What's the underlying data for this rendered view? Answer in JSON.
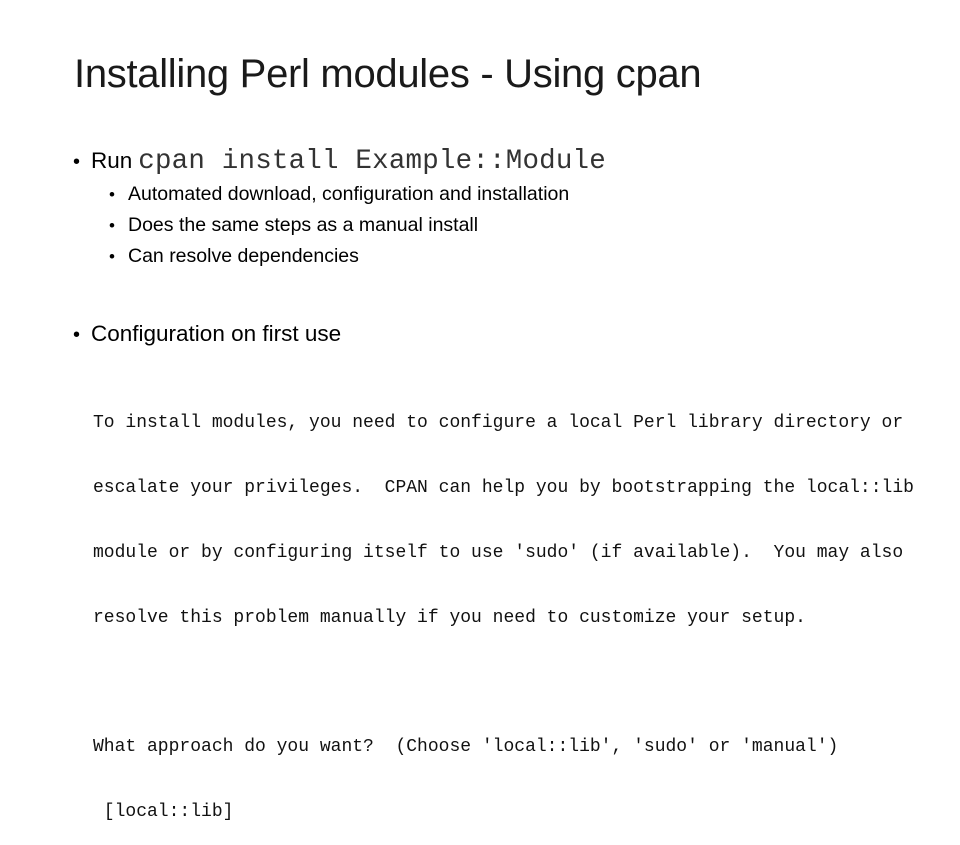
{
  "slide": {
    "title": "Installing Perl modules - Using cpan",
    "bullets": [
      {
        "label": "Run",
        "code": "cpan install Example::Module",
        "sub_bullets": [
          "Automated download, configuration and installation",
          "Does the same steps as a manual install",
          "Can resolve dependencies"
        ]
      },
      {
        "label": "Configuration on first use"
      }
    ],
    "terminal_output": {
      "lines": [
        "To install modules, you need to configure a local Perl library directory or",
        "escalate your privileges.  CPAN can help you by bootstrapping the local::lib",
        "module or by configuring itself to use 'sudo' (if available).  You may also",
        "resolve this problem manually if you need to customize your setup.",
        "",
        "What approach do you want?  (Choose 'local::lib', 'sudo' or 'manual')",
        " [local::lib]"
      ]
    },
    "bullet_glyph": "•"
  }
}
